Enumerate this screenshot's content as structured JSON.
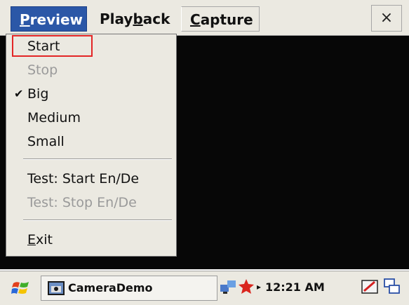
{
  "menubar": {
    "preview": {
      "before": "",
      "mnemonic": "P",
      "after": "review"
    },
    "playback": {
      "before": "Play",
      "mnemonic": "b",
      "after": "ack"
    },
    "capture": {
      "before": "",
      "mnemonic": "C",
      "after": "apture"
    },
    "close_label": "×"
  },
  "dropdown": {
    "start": "Start",
    "stop": "Stop",
    "big": "Big",
    "big_check": "✔",
    "medium": "Medium",
    "small": "Small",
    "test_start": "Test: Start En/De",
    "test_stop": "Test: Stop En/De",
    "exit": {
      "mnemonic": "E",
      "after": "xit"
    }
  },
  "taskbar": {
    "app_label": "CameraDemo",
    "tray_arrow": "▸",
    "clock": "12:21 AM"
  },
  "colors": {
    "menu_highlight": "#2b57a7",
    "selection_outline": "#e32626",
    "preview_background": "#070707",
    "chrome": "#ebe9e1"
  },
  "icons": {
    "start": "windows-flag-icon",
    "app": "camera-app-icon",
    "network": "network-icon",
    "tray_app": "tray-app-icon",
    "input": "input-panel-icon",
    "desktop": "desktop-switch-icon"
  }
}
